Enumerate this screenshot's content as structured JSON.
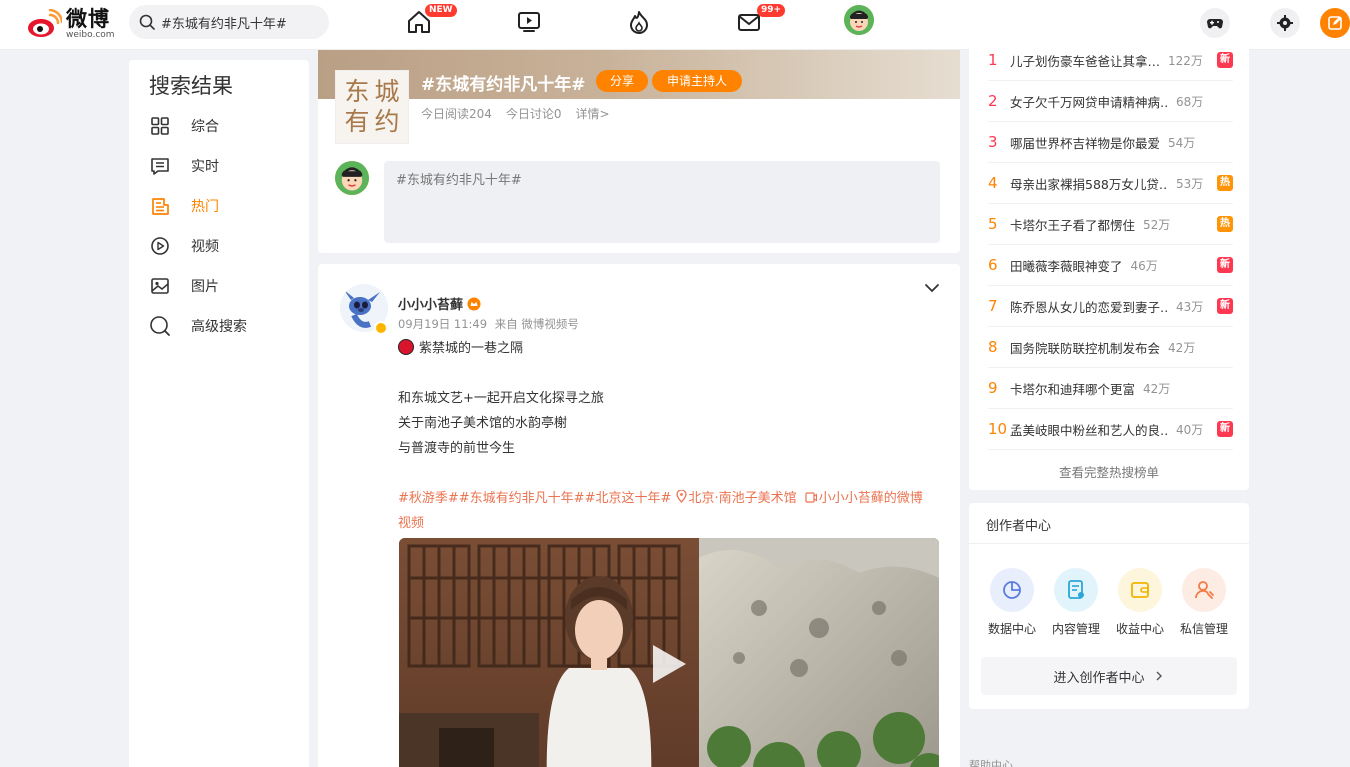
{
  "app": {
    "logo_cn": "微博",
    "logo_en": "weibo.com"
  },
  "search": {
    "value": "#东城有约非凡十年#"
  },
  "topnav": {
    "home_badge": "NEW",
    "messages_badge": "99+"
  },
  "leftnav": {
    "title": "搜索结果",
    "items": [
      {
        "label": "综合",
        "icon": "grid-icon"
      },
      {
        "label": "实时",
        "icon": "realtime-icon"
      },
      {
        "label": "热门",
        "icon": "hot-icon"
      },
      {
        "label": "视频",
        "icon": "video-icon"
      },
      {
        "label": "图片",
        "icon": "image-icon"
      },
      {
        "label": "高级搜索",
        "icon": "search-icon"
      }
    ],
    "active_index": 2
  },
  "topic": {
    "thumb_chars": [
      "东",
      "城",
      "有",
      "约"
    ],
    "title": "#东城有约非凡十年#",
    "share_label": "分享",
    "host_label": "申请主持人",
    "reads": "今日阅读204",
    "discussions": "今日讨论0",
    "details": "详情>",
    "comment_placeholder": "#东城有约非凡十年#"
  },
  "post": {
    "author": "小小小苔藓",
    "time": "09月19日 11:49",
    "source": "来自 微博视频号",
    "lines": [
      "紫禁城的一巷之隔",
      "",
      "和东城文艺+一起开启文化探寻之旅",
      "关于南池子美术馆的水韵亭榭",
      "与普渡寺的前世今生",
      ""
    ],
    "tags_line1": "#秋游季##东城有约非凡十年##北京这十年# ",
    "location": "北京·南池子美术馆",
    "video_link_1": "小小小苔藓的微博",
    "video_link_2": "视频"
  },
  "hot": {
    "items": [
      {
        "rank": "1",
        "title": "儿子划伤豪车爸爸让其拿…",
        "count": "122万",
        "tag": "新",
        "rank_color": "#ff3852",
        "tag_color": "#ff3852"
      },
      {
        "rank": "2",
        "title": "女子欠千万网贷申请精神病…",
        "count": "68万",
        "tag": "",
        "rank_color": "#ff3852",
        "tag_color": ""
      },
      {
        "rank": "3",
        "title": "哪届世界杯吉祥物是你最爱",
        "count": "54万",
        "tag": "",
        "rank_color": "#ff3852",
        "tag_color": ""
      },
      {
        "rank": "4",
        "title": "母亲出家裸捐588万女儿贷…",
        "count": "53万",
        "tag": "热",
        "rank_color": "#ff8200",
        "tag_color": "#ff9406"
      },
      {
        "rank": "5",
        "title": "卡塔尔王子看了都愣住",
        "count": "52万",
        "tag": "热",
        "rank_color": "#ff8200",
        "tag_color": "#ff9406"
      },
      {
        "rank": "6",
        "title": "田曦薇李薇眼神变了",
        "count": "46万",
        "tag": "新",
        "rank_color": "#ff8200",
        "tag_color": "#ff3852"
      },
      {
        "rank": "7",
        "title": "陈乔恩从女儿的恋爱到妻子…",
        "count": "43万",
        "tag": "新",
        "rank_color": "#ff8200",
        "tag_color": "#ff3852"
      },
      {
        "rank": "8",
        "title": "国务院联防联控机制发布会",
        "count": "42万",
        "tag": "",
        "rank_color": "#ff8200",
        "tag_color": ""
      },
      {
        "rank": "9",
        "title": "卡塔尔和迪拜哪个更富",
        "count": "42万",
        "tag": "",
        "rank_color": "#ff8200",
        "tag_color": ""
      },
      {
        "rank": "10",
        "title": "孟美岐眼中粉丝和艺人的良…",
        "count": "40万",
        "tag": "新",
        "rank_color": "#ff8200",
        "tag_color": "#ff3852"
      }
    ],
    "more": "查看完整热搜榜单"
  },
  "creator": {
    "title": "创作者中心",
    "items": [
      {
        "label": "数据中心",
        "icon": "data-icon",
        "bg": "#e8eefc",
        "fg": "#5a7be0"
      },
      {
        "label": "内容管理",
        "icon": "content-icon",
        "bg": "#e2f4fb",
        "fg": "#2aa6d8"
      },
      {
        "label": "收益中心",
        "icon": "income-icon",
        "bg": "#fdf5dc",
        "fg": "#f0b400"
      },
      {
        "label": "私信管理",
        "icon": "message-manage-icon",
        "bg": "#fdece4",
        "fg": "#f27b43"
      }
    ],
    "enter_label": "进入创作者中心"
  },
  "footer": {
    "help": "帮助中心"
  },
  "colors": {
    "accent": "#ff8200",
    "tag": "#eb7350"
  }
}
